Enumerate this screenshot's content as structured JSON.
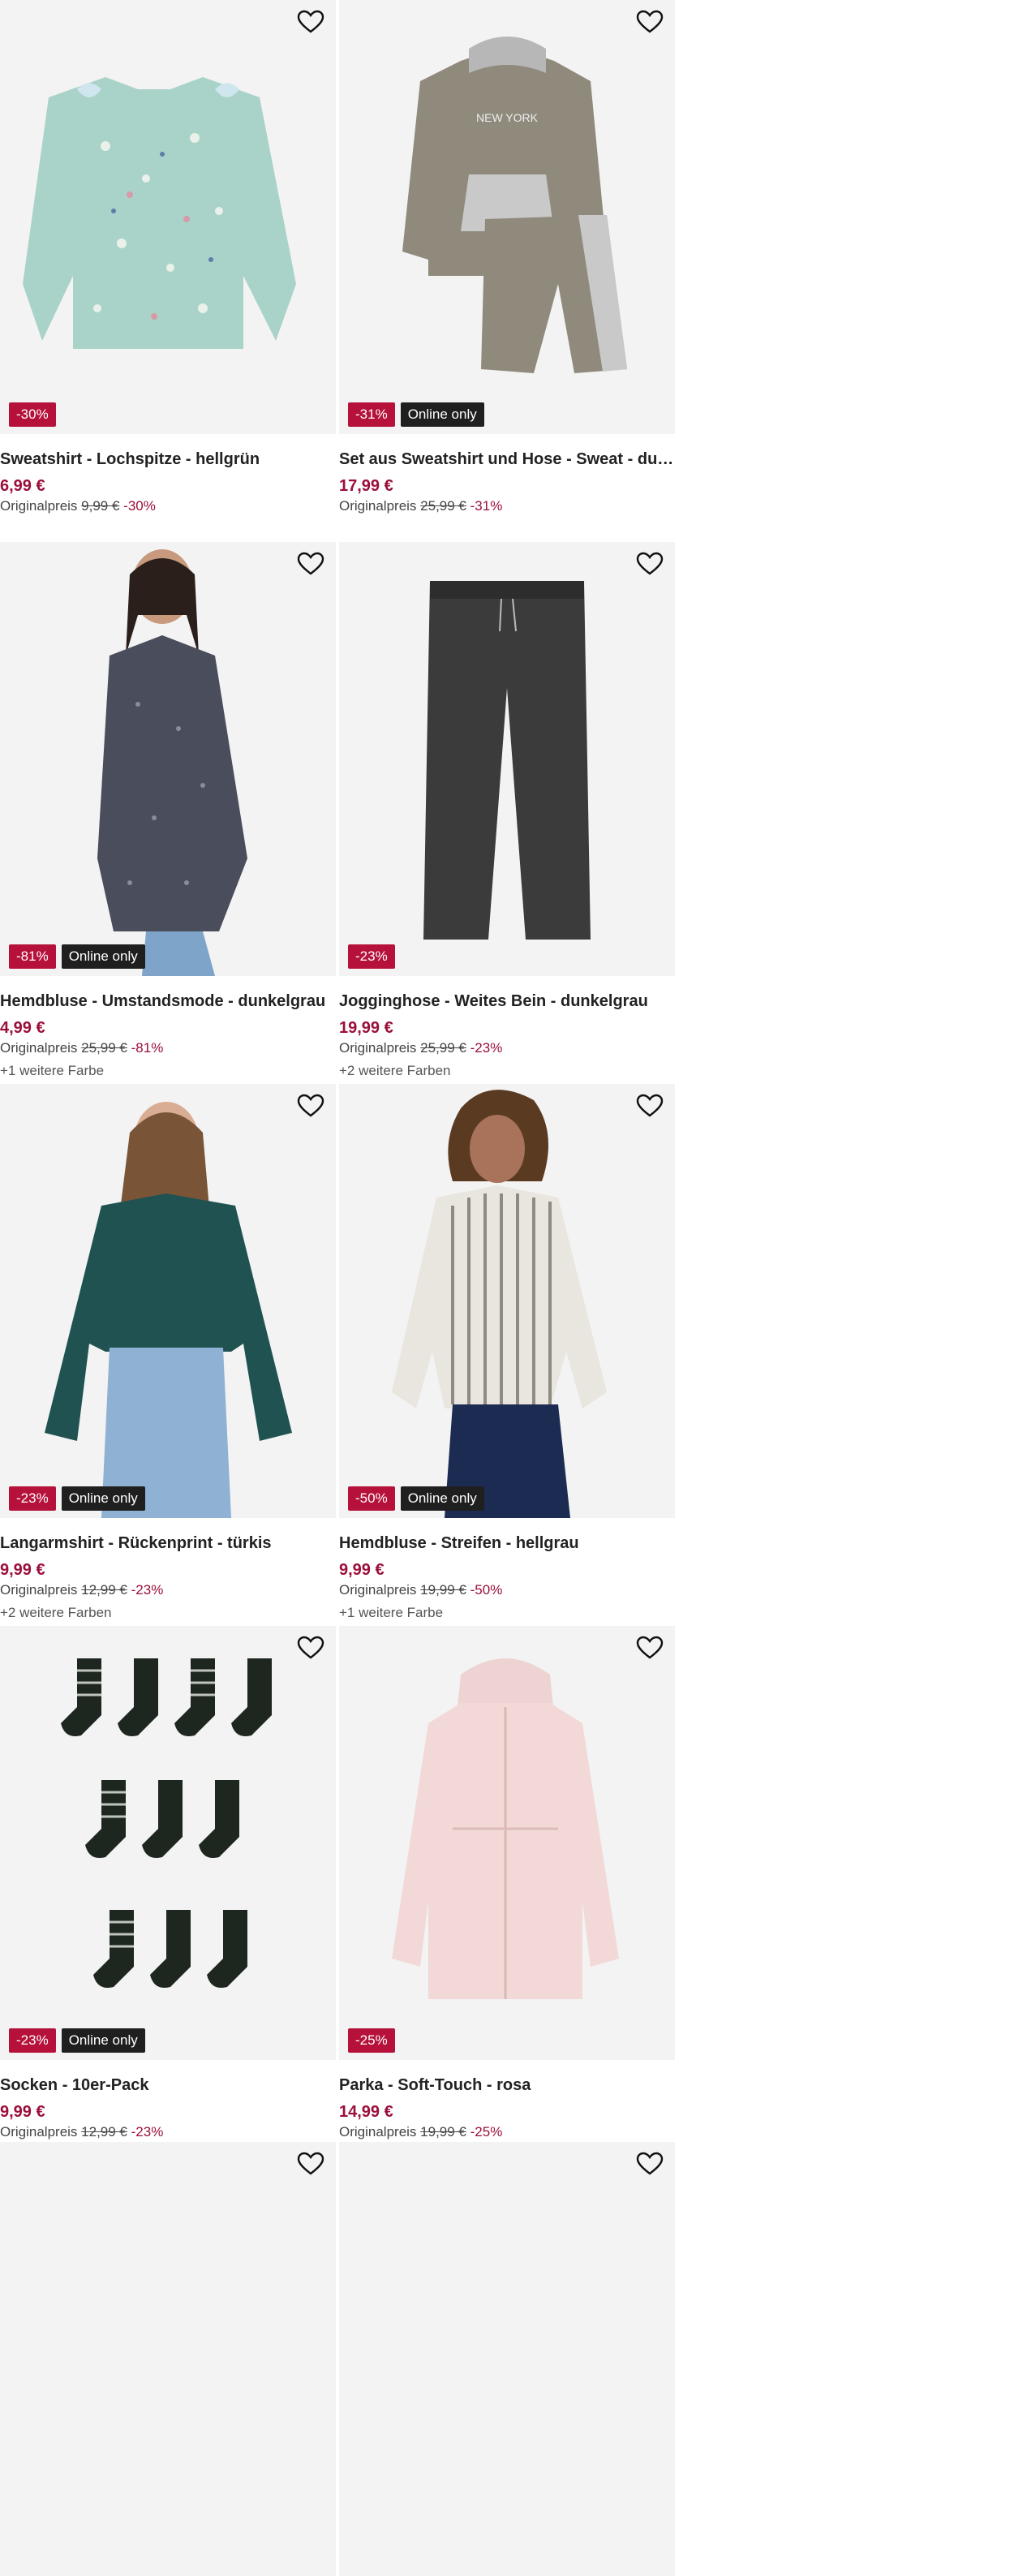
{
  "products": [
    {
      "title": "Sweatshirt - Lochspitze - hellgrün",
      "price": "6,99 €",
      "orig_label": "Originalpreis",
      "orig_price": "9,99 €",
      "discount": "-30%",
      "badge_sale": "-30%",
      "badge_online": "",
      "colors": "",
      "icon": "heart-icon"
    },
    {
      "title": "Set aus Sweatshirt und Hose - Sweat - dunk...",
      "price": "17,99 €",
      "orig_label": "Originalpreis",
      "orig_price": "25,99 €",
      "discount": "-31%",
      "badge_sale": "-31%",
      "badge_online": "Online only",
      "colors": "",
      "icon": "heart-icon"
    },
    {
      "title": "Hemdbluse - Umstandsmode - dunkelgrau",
      "price": "4,99 €",
      "orig_label": "Originalpreis",
      "orig_price": "25,99 €",
      "discount": "-81%",
      "badge_sale": "-81%",
      "badge_online": "Online only",
      "colors": "+1 weitere Farbe",
      "icon": "heart-icon"
    },
    {
      "title": "Jogginghose - Weites Bein - dunkelgrau",
      "price": "19,99 €",
      "orig_label": "Originalpreis",
      "orig_price": "25,99 €",
      "discount": "-23%",
      "badge_sale": "-23%",
      "badge_online": "",
      "colors": "+2 weitere Farben",
      "icon": "heart-icon"
    },
    {
      "title": "Langarmshirt - Rückenprint - türkis",
      "price": "9,99 €",
      "orig_label": "Originalpreis",
      "orig_price": "12,99 €",
      "discount": "-23%",
      "badge_sale": "-23%",
      "badge_online": "Online only",
      "colors": "+2 weitere Farben",
      "icon": "heart-icon"
    },
    {
      "title": "Hemdbluse - Streifen - hellgrau",
      "price": "9,99 €",
      "orig_label": "Originalpreis",
      "orig_price": "19,99 €",
      "discount": "-50%",
      "badge_sale": "-50%",
      "badge_online": "Online only",
      "colors": "+1 weitere Farbe",
      "icon": "heart-icon"
    },
    {
      "title": "Socken - 10er-Pack",
      "price": "9,99 €",
      "orig_label": "Originalpreis",
      "orig_price": "12,99 €",
      "discount": "-23%",
      "badge_sale": "-23%",
      "badge_online": "Online only",
      "colors": "",
      "icon": "heart-icon"
    },
    {
      "title": "Parka - Soft-Touch - rosa",
      "price": "14,99 €",
      "orig_label": "Originalpreis",
      "orig_price": "19,99 €",
      "discount": "-25%",
      "badge_sale": "-25%",
      "badge_online": "",
      "colors": "",
      "icon": "heart-icon"
    }
  ],
  "colors": {
    "sale": "#b5113a",
    "price": "#9b0f3a",
    "online": "#1f1f1f",
    "image_bg": "#f3f3f3"
  }
}
